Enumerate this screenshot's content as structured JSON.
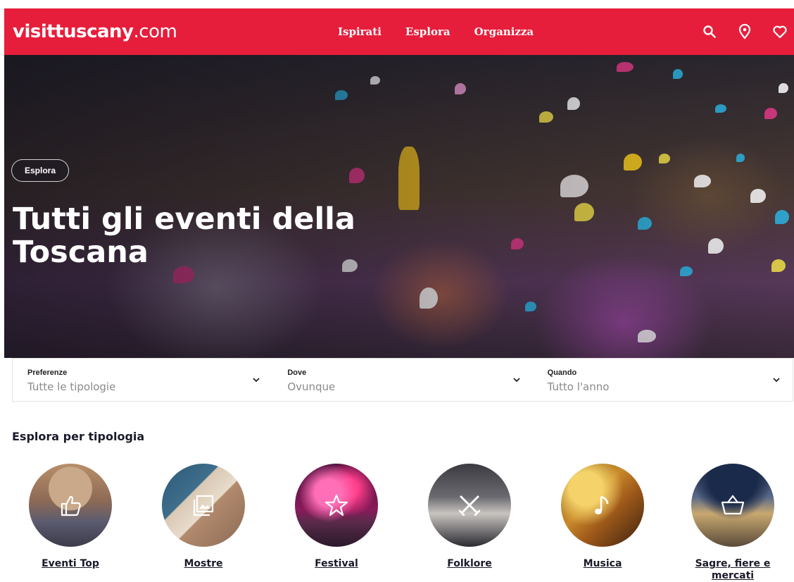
{
  "header": {
    "logo_main": "visittuscany",
    "logo_tld": ".com",
    "nav": [
      "Ispirati",
      "Esplora",
      "Organizza"
    ],
    "icons": [
      "search-icon",
      "location-pin-icon",
      "heart-icon"
    ],
    "brand_color": "#e61e3b"
  },
  "hero": {
    "tag": "Esplora",
    "title": "Tutti gli eventi della Toscana"
  },
  "filters": [
    {
      "label": "Preferenze",
      "value": "Tutte le tipologie"
    },
    {
      "label": "Dove",
      "value": "Ovunque"
    },
    {
      "label": "Quando",
      "value": "Tutto l'anno"
    }
  ],
  "section": {
    "title": "Esplora per tipologia",
    "categories": [
      {
        "label": "Eventi Top",
        "icon": "thumbs-up-icon"
      },
      {
        "label": "Mostre",
        "icon": "gallery-icon"
      },
      {
        "label": "Festival",
        "icon": "star-icon"
      },
      {
        "label": "Folklore",
        "icon": "crossed-swords-icon"
      },
      {
        "label": "Musica",
        "icon": "music-note-icon"
      },
      {
        "label": "Sagre, fiere e mercati",
        "icon": "basket-icon"
      }
    ]
  }
}
